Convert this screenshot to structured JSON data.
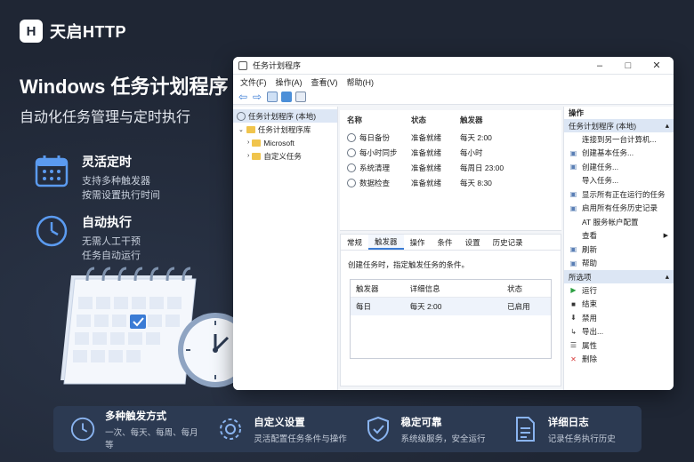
{
  "brand": {
    "name": "天启HTTP"
  },
  "hero": {
    "title": "Windows 任务计划程序",
    "subtitle": "自动化任务管理与定时执行"
  },
  "features": [
    {
      "title": "灵活定时",
      "line1": "支持多种触发器",
      "line2": "按需设置执行时间"
    },
    {
      "title": "自动执行",
      "line1": "无需人工干预",
      "line2": "任务自动运行"
    }
  ],
  "window": {
    "title": "任务计划程序",
    "menu": [
      "文件(F)",
      "操作(A)",
      "查看(V)",
      "帮助(H)"
    ],
    "tree": [
      {
        "label": "任务计划程序 (本地)"
      },
      {
        "label": "任务计划程序库"
      },
      {
        "label": "Microsoft"
      },
      {
        "label": "自定义任务"
      }
    ],
    "task_columns": [
      "名称",
      "状态",
      "触发器"
    ],
    "tasks": [
      {
        "name": "每日备份",
        "status": "准备就绪",
        "trigger": "每天 2:00"
      },
      {
        "name": "每小时同步",
        "status": "准备就绪",
        "trigger": "每小时"
      },
      {
        "name": "系统清理",
        "status": "准备就绪",
        "trigger": "每周日 23:00"
      },
      {
        "name": "数据检查",
        "status": "准备就绪",
        "trigger": "每天 8:30"
      }
    ],
    "tabs": [
      "常规",
      "触发器",
      "操作",
      "条件",
      "设置",
      "历史记录"
    ],
    "active_tab": "触发器",
    "trigger_hint": "创建任务时，指定触发任务的条件。",
    "trigger_columns": [
      "触发器",
      "详细信息",
      "状态"
    ],
    "trigger_row": {
      "trigger": "每日",
      "detail": "每天 2:00",
      "status": "已启用"
    },
    "actions_header": "操作",
    "actions_section1": "任务计划程序 (本地)",
    "actions1": [
      {
        "label": "连接到另一台计算机...",
        "icon": "none"
      },
      {
        "label": "创建基本任务...",
        "icon": "task-wizard-icon"
      },
      {
        "label": "创建任务...",
        "icon": "star-icon"
      },
      {
        "label": "导入任务...",
        "icon": "none"
      },
      {
        "label": "显示所有正在运行的任务",
        "icon": "list-icon"
      },
      {
        "label": "启用所有任务历史记录",
        "icon": "history-icon"
      },
      {
        "label": "AT 服务帐户配置",
        "icon": "none"
      },
      {
        "label": "查看",
        "icon": "none"
      },
      {
        "label": "刷新",
        "icon": "refresh-icon"
      },
      {
        "label": "帮助",
        "icon": "help-icon"
      }
    ],
    "actions_section2": "所选项",
    "actions2": [
      {
        "label": "运行",
        "icon": "play-icon",
        "glyph": "▶",
        "color": "#2ea043"
      },
      {
        "label": "结束",
        "icon": "stop-icon",
        "glyph": "■",
        "color": "#333333"
      },
      {
        "label": "禁用",
        "icon": "disable-icon",
        "glyph": "⬇",
        "color": "#444444"
      },
      {
        "label": "导出...",
        "icon": "export-icon",
        "glyph": "↳",
        "color": "#444444"
      },
      {
        "label": "属性",
        "icon": "properties-icon",
        "glyph": "☰",
        "color": "#444444"
      },
      {
        "label": "删除",
        "icon": "delete-icon",
        "glyph": "✕",
        "color": "#d73a3a"
      }
    ]
  },
  "bottom": [
    {
      "title": "多种触发方式",
      "desc": "一次、每天、每周、每月等"
    },
    {
      "title": "自定义设置",
      "desc": "灵活配置任务条件与操作"
    },
    {
      "title": "稳定可靠",
      "desc": "系统级服务，安全运行"
    },
    {
      "title": "详细日志",
      "desc": "记录任务执行历史"
    }
  ],
  "colors": {
    "background": "#1f2634",
    "accent": "#3a7bd5",
    "bottom_bar": "#2c3a52"
  }
}
